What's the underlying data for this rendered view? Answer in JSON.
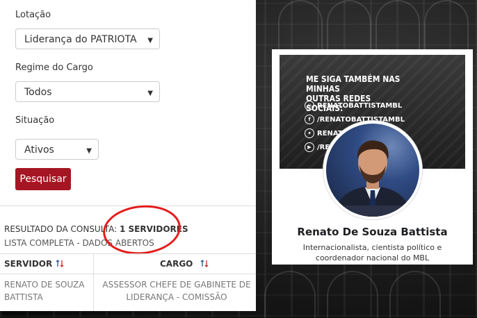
{
  "form": {
    "lotacao_label": "Lotação",
    "lotacao_value": "Liderança do PATRIOTA",
    "regime_label": "Regime do Cargo",
    "regime_value": "Todos",
    "situacao_label": "Situação",
    "situacao_value": "Ativos",
    "search_button": "Pesquisar"
  },
  "results": {
    "summary_prefix": "RESULTADO DA CONSULTA:",
    "count": "1 SERVIDORES",
    "subtitle": "LISTA COMPLETA - DADOS ABERTOS",
    "columns": [
      "SERVIDOR",
      "CARGO"
    ],
    "rows": [
      {
        "servidor": [
          "RENATO DE SOUZA",
          "BATTISTA"
        ],
        "cargo": [
          "ASSESSOR CHEFE DE GABINETE DE",
          "LIDERANÇA - COMISSÃO"
        ]
      }
    ]
  },
  "profile": {
    "cover_heading": [
      "ME SIGA TAMBÉM NAS MINHAS",
      "OUTRAS REDES SOCIAIS:"
    ],
    "social_links": [
      {
        "icon": "instagram-icon",
        "glyph": "◎",
        "text": "RENATOBATTISTAMBL"
      },
      {
        "icon": "facebook-icon",
        "glyph": "f",
        "text": "/RENATOBATTISTAMBL"
      },
      {
        "icon": "twitter-icon",
        "glyph": "✦",
        "text": "RENATOMBL"
      },
      {
        "icon": "youtube-icon",
        "glyph": "▶",
        "text": "/RENATOBATTISTA"
      }
    ],
    "name": "Renato De Souza Battista",
    "bio": "Internacionalista, cientista político e coordenador nacional do MBL"
  },
  "colors": {
    "button": "#a51622",
    "highlight_circle": "#e31c1c",
    "sort_blue": "#3b5998",
    "sort_red": "#c0392b"
  }
}
